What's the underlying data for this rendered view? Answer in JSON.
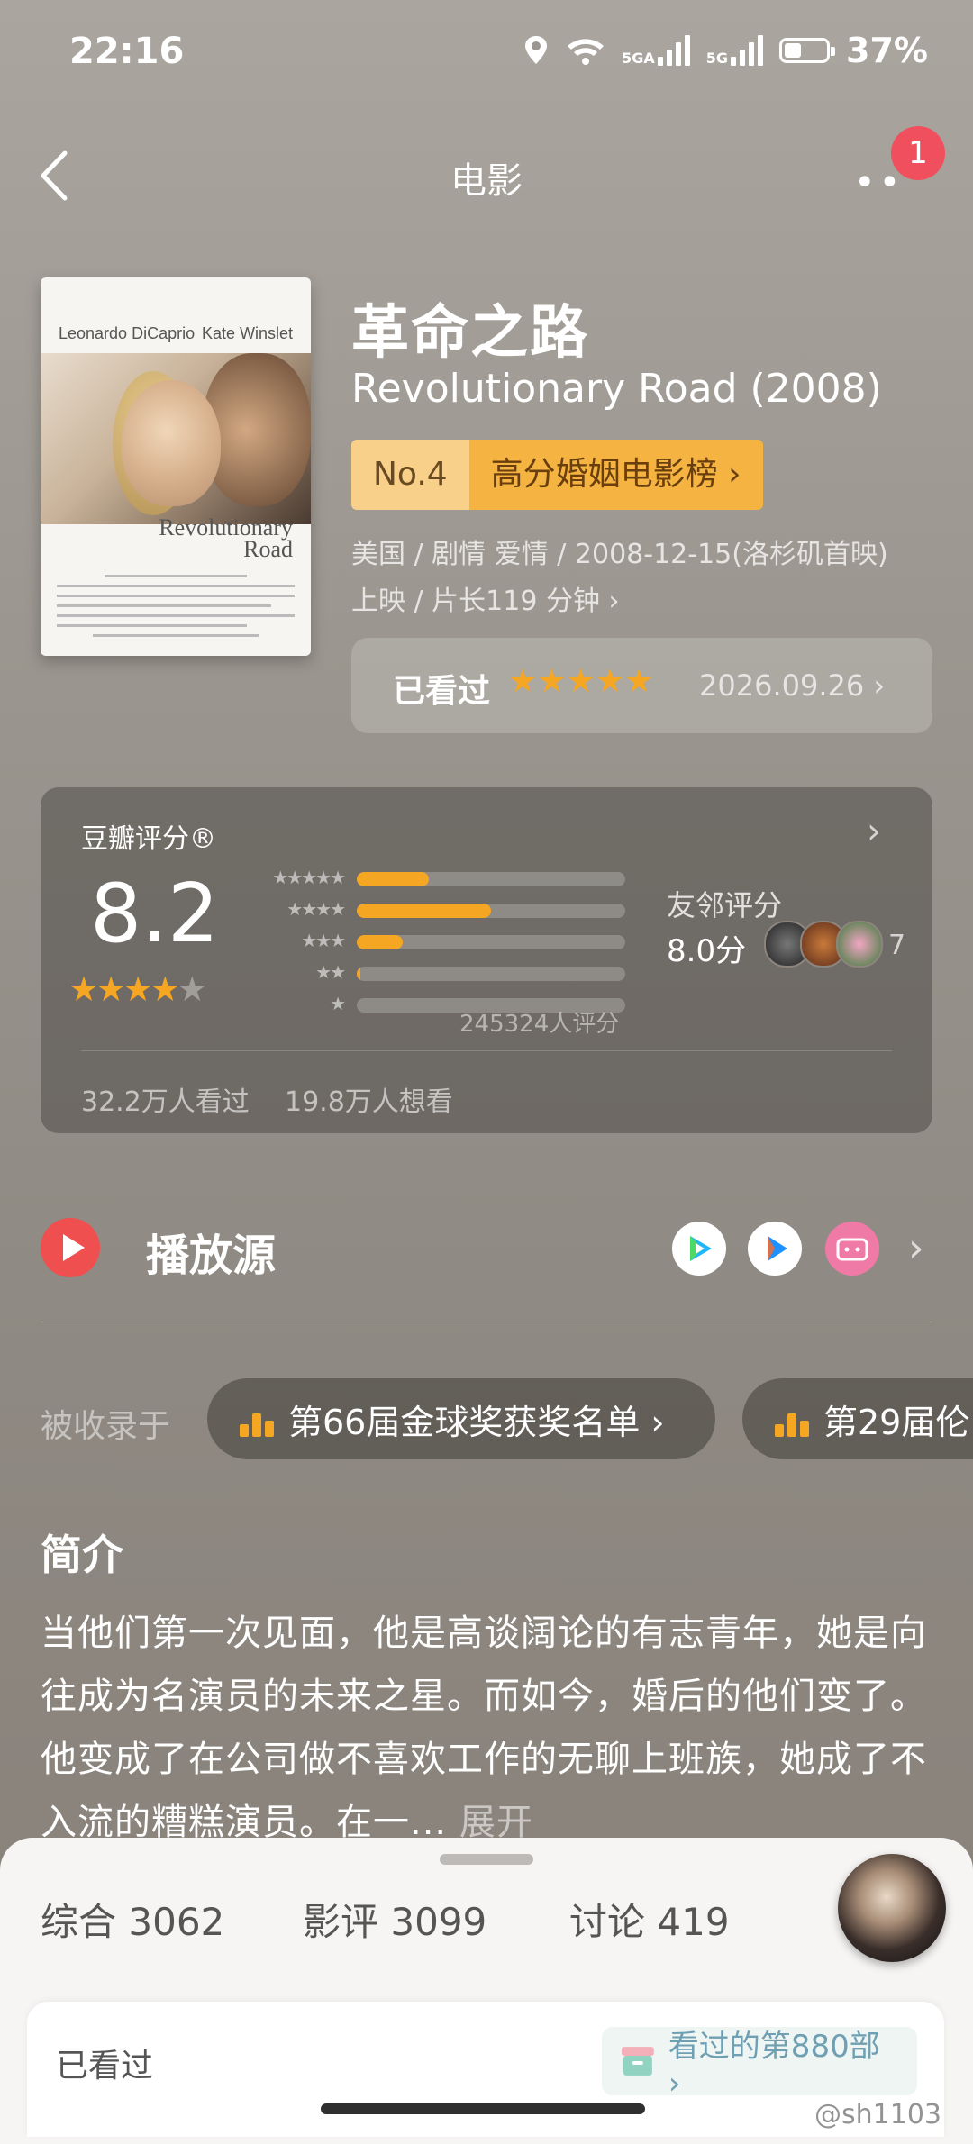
{
  "status": {
    "time": "22:16",
    "net1": "5GA",
    "net2": "5G",
    "battery": "37%"
  },
  "nav": {
    "title": "电影",
    "badge": "1",
    "more": "••"
  },
  "poster": {
    "actor1": "Leonardo DiCaprio",
    "actor2": "Kate Winslet",
    "title_line1": "Revolutionary",
    "title_line2": "Road"
  },
  "movie": {
    "title_cn": "革命之路",
    "title_en": "Revolutionary Road (2008)",
    "rank_no": "No.4",
    "rank_name": "高分婚姻电影榜 ›",
    "meta_line1": "美国 / 剧情 爱情 / 2008-12-15(洛杉矶首映)",
    "meta_line2": "上映 / 片长119 分钟 ›"
  },
  "seen": {
    "label": "已看过",
    "stars": "★★★★★",
    "date": "2026.09.26 ›"
  },
  "rating": {
    "title": "豆瓣评分®",
    "score": "8.2",
    "stars": "★★★★",
    "star_empty": "★",
    "dist_labels": [
      "★★★★★",
      "★★★★",
      "★★★",
      "★★",
      "★"
    ],
    "dist_values": [
      0.27,
      0.5,
      0.17,
      0.01,
      0.0
    ],
    "count": "245324人评分",
    "friends_label": "友邻评分",
    "friends_score": "8.0分",
    "friends_count": "7",
    "watched": "32.2万人看过",
    "want": "19.8万人想看"
  },
  "play": {
    "label": "播放源"
  },
  "collections": {
    "label": "被收录于",
    "items": [
      "第66届金球奖获奖名单 ›",
      "第29届伦"
    ]
  },
  "intro": {
    "heading": "简介",
    "text": "当他们第一次见面，他是高谈阔论的有志青年，她是向往成为名演员的未来之星。而如今，婚后的他们变了。他变成了在公司做不喜欢工作的无聊上班族，她成了不入流的糟糕演员。在一...",
    "expand": " 展开"
  },
  "tabs": [
    {
      "label": "综合",
      "count": "3062"
    },
    {
      "label": "影评",
      "count": "3099"
    },
    {
      "label": "讨论",
      "count": "419"
    }
  ],
  "lower": {
    "left": "已看过",
    "chip": "看过的第880部 ›"
  },
  "watermark": "@sh1103",
  "colors": {
    "accent": "#f5a623",
    "play_red": "#f04f4f",
    "badge": "#f04f5d"
  }
}
